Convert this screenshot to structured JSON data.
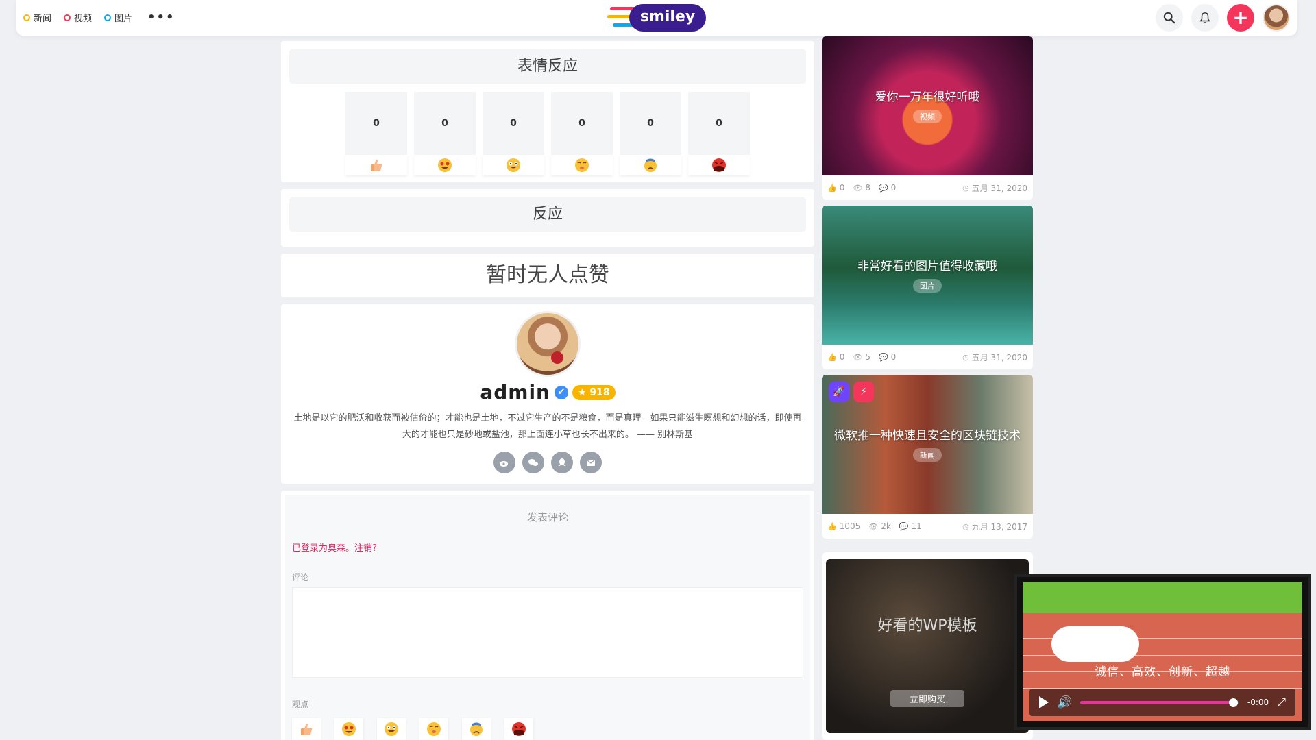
{
  "header": {
    "nav": [
      {
        "label": "新闻",
        "color": "#f7b500"
      },
      {
        "label": "视频",
        "color": "#f5365c"
      },
      {
        "label": "图片",
        "color": "#11a9e8"
      }
    ],
    "more": "•••",
    "logo_text": "smiley"
  },
  "reactions": {
    "title": "表情反应",
    "items": [
      {
        "count": "0",
        "emoji": "thumb-up"
      },
      {
        "count": "0",
        "emoji": "heart-eyes"
      },
      {
        "count": "0",
        "emoji": "laugh"
      },
      {
        "count": "0",
        "emoji": "wow"
      },
      {
        "count": "0",
        "emoji": "sad"
      },
      {
        "count": "0",
        "emoji": "angry"
      }
    ]
  },
  "reaction_title": "反应",
  "no_likes": "暂时无人点赞",
  "profile": {
    "name": "admin",
    "verified_icon": "✔",
    "badge": "★ 918",
    "bio": "土地是以它的肥沃和收获而被估价的；才能也是土地，不过它生产的不是粮食，而是真理。如果只能滋生瞑想和幻想的话，即使再大的才能也只是砂地或盐池，那上面连小草也长不出来的。 —— 别林斯基",
    "socials": [
      "weibo-icon",
      "wechat-icon",
      "qq-icon",
      "email-icon"
    ]
  },
  "comment": {
    "title": "发表评论",
    "logged_prefix": "已登录为奥森。",
    "logout": "注销?",
    "comment_label": "评论",
    "opinion_label": "观点",
    "opinions": [
      {
        "label": "喜欢"
      },
      {
        "label": "酷爱"
      },
      {
        "label": "哈哈"
      },
      {
        "label": "哇哩"
      },
      {
        "label": "难过"
      },
      {
        "label": "生气"
      }
    ]
  },
  "posts": [
    {
      "title": "爱你一万年很好听哦",
      "category": "视频",
      "likes": "0",
      "views": "8",
      "comments": "0",
      "date": "五月 31, 2020"
    },
    {
      "title": "非常好看的图片值得收藏哦",
      "category": "图片",
      "likes": "0",
      "views": "5",
      "comments": "0",
      "date": "五月 31, 2020"
    },
    {
      "title": "微软推一种快速且安全的区块链技术",
      "category": "新闻",
      "likes": "1005",
      "views": "2k",
      "comments": "11",
      "date": "九月 13, 2017"
    }
  ],
  "ad": {
    "title": "好看的WP模板",
    "button": "立即购买"
  },
  "video": {
    "caption": "诚信、高效、创新、超越",
    "time": "-0:00",
    "progress": 0.96
  }
}
